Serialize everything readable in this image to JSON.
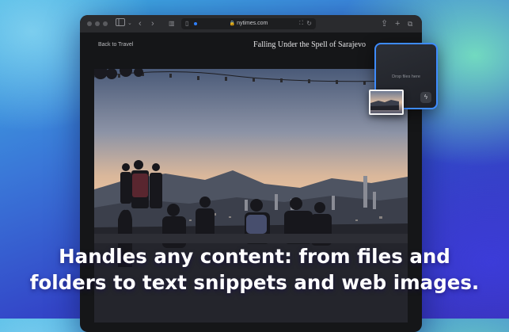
{
  "browser": {
    "url": "nytimes.com",
    "icons": {
      "sidebar": "sidebar-icon",
      "back": "chevron-left-icon",
      "forward": "chevron-right-icon",
      "tabs_overview": "grid-icon",
      "share": "share-icon",
      "new_tab": "plus-icon",
      "tab_overview": "copy-icon",
      "reader": "reader-icon",
      "translate": "translate-icon",
      "reload": "reload-icon",
      "lock": "lock-icon"
    }
  },
  "article": {
    "back_link": "Back to Travel",
    "title": "Falling Under the Spell of Sarajevo"
  },
  "drop_panel": {
    "label": "Drop files here",
    "action_icon": "bolt-icon",
    "accent": "#3d8bff"
  },
  "caption": {
    "line1": "Handles any content: from files and",
    "line2": "folders to text snippets and web images."
  }
}
